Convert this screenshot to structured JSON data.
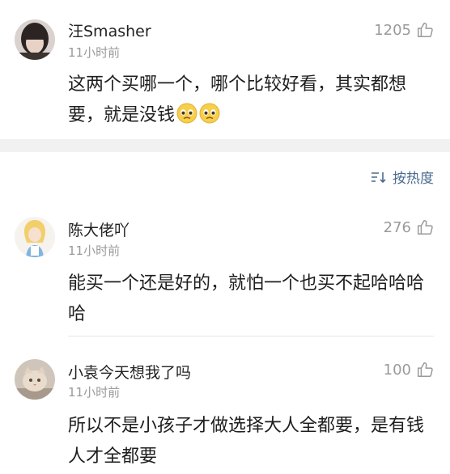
{
  "top_comment": {
    "username": "汪Smasher",
    "time": "11小时前",
    "likes": "1205",
    "text": "这两个买哪一个，哪个比较好看，其实都想要，就是没钱"
  },
  "sort": {
    "label": "按热度"
  },
  "replies": [
    {
      "username": "陈大佬吖",
      "time": "11小时前",
      "likes": "276",
      "text": "能买一个还是好的，就怕一个也买不起哈哈哈哈"
    },
    {
      "username": "小袁今天想我了吗",
      "time": "11小时前",
      "likes": "100",
      "text": "所以不是小孩子才做选择大人全都要，是有钱人才全都要"
    }
  ],
  "colors": {
    "link": "#4a6a8f",
    "muted": "#9a9a9a",
    "separator": "#f1f1f1"
  }
}
